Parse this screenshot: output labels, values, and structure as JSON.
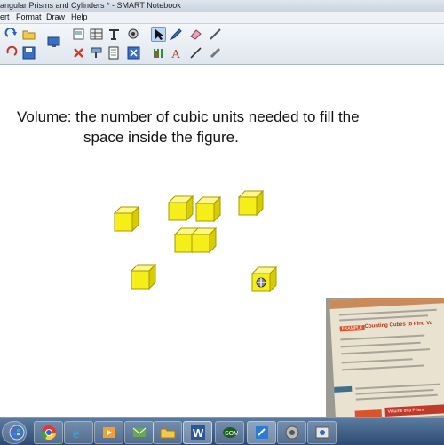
{
  "window": {
    "title": "angular Prisms and Cylinders * - SMART Notebook"
  },
  "menu": [
    {
      "label": "ert"
    },
    {
      "label": "Format"
    },
    {
      "label": "Draw"
    },
    {
      "label": "Help"
    }
  ],
  "toolbar": {
    "icons": [
      "redo-icon",
      "open-folder-icon",
      "screen-capture-icon",
      "full-screen-icon",
      "table-icon",
      "clear-page-icon",
      "document-camera-icon",
      "delete-icon",
      "screen-shade-icon",
      "save-icon",
      "display-icon",
      "resize-icon",
      "select-arrow-icon",
      "pen-icon",
      "eraser-icon",
      "line-icon",
      "creative-pen-icon",
      "text-icon",
      "shapes-icon",
      "magic-pen-icon"
    ]
  },
  "canvas": {
    "definition_line1": "Volume: the number of cubic units needed to fill the",
    "definition_line2": "space inside the figure.",
    "cube_color": "#f5ee18",
    "cube_count": 9
  },
  "webcam": {
    "book_label_1": "EXAMPLE",
    "book_label_2": "Counting Cubes to Find Vo",
    "book_label_3": "Volume of a Prism"
  },
  "taskbar": {
    "icons": [
      "chrome-icon",
      "explorer-icon",
      "media-player-icon",
      "mail-icon",
      "folder-icon",
      "paint-icon",
      "word-icon",
      "app-icon",
      "notebook-icon",
      "tool-icon",
      "capture-icon"
    ]
  }
}
